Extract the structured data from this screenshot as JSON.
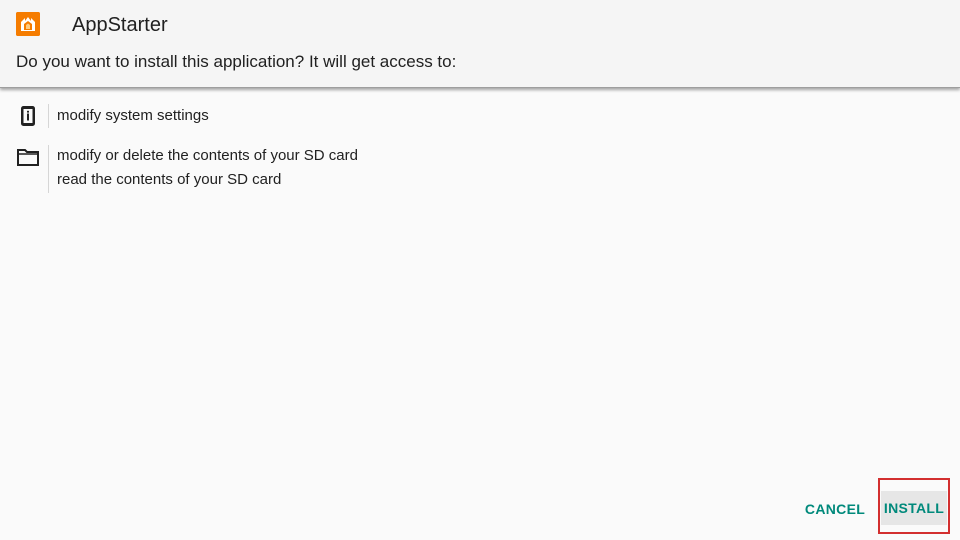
{
  "dialog": {
    "app_icon": "appstarter-app-icon",
    "app_name": "AppStarter",
    "prompt": "Do you want to install this application? It will get access to:"
  },
  "permissions": [
    {
      "icon": "device-info-icon",
      "lines": [
        "modify system settings"
      ]
    },
    {
      "icon": "folder-icon",
      "lines": [
        "modify or delete the contents of your SD card",
        "read the contents of your SD card"
      ]
    }
  ],
  "buttons": {
    "cancel": "CANCEL",
    "install": "INSTALL"
  },
  "colors": {
    "accent": "#00897b",
    "highlight_frame": "#d32f2f",
    "app_icon_bg": "#f57c00"
  }
}
